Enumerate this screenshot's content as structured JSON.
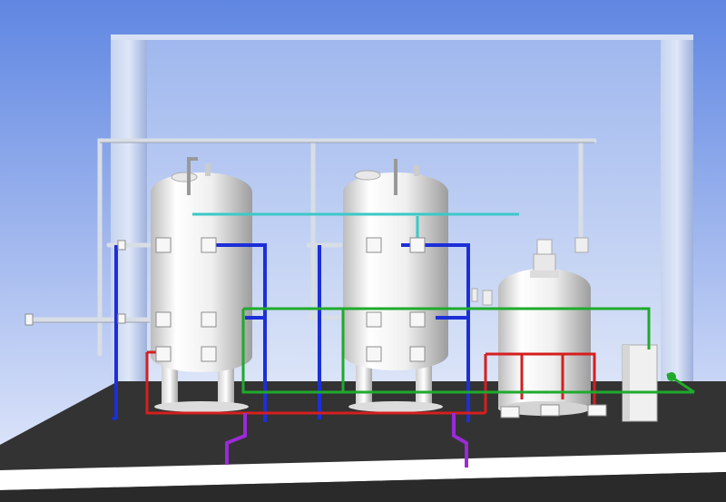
{
  "scene": {
    "kind": "3d-water-treatment-skid",
    "vessels": [
      {
        "id": "filter-tank-1",
        "role": "pressure filter"
      },
      {
        "id": "filter-tank-2",
        "role": "pressure filter"
      },
      {
        "id": "dosing-tank",
        "role": "chemical tank with agitator"
      }
    ],
    "pipe_lines": [
      {
        "id": "raw-water",
        "color": "#1c2fd8"
      },
      {
        "id": "backwash",
        "color": "#d41f1f"
      },
      {
        "id": "clean-water",
        "color": "#1faa2c"
      },
      {
        "id": "air-line",
        "color": "#3cc8c8"
      },
      {
        "id": "drain",
        "color": "#9a2ad8"
      },
      {
        "id": "header",
        "color": "#d8dde6"
      }
    ],
    "colors": {
      "sky_top": "#5f86e2",
      "sky_bottom": "#e9eefc",
      "frame": "#b8c7e8",
      "glass": "#a9c0ef",
      "floor": "#333333",
      "floor_edge": "#ffffff",
      "vessel": "#f1f1f1"
    }
  }
}
